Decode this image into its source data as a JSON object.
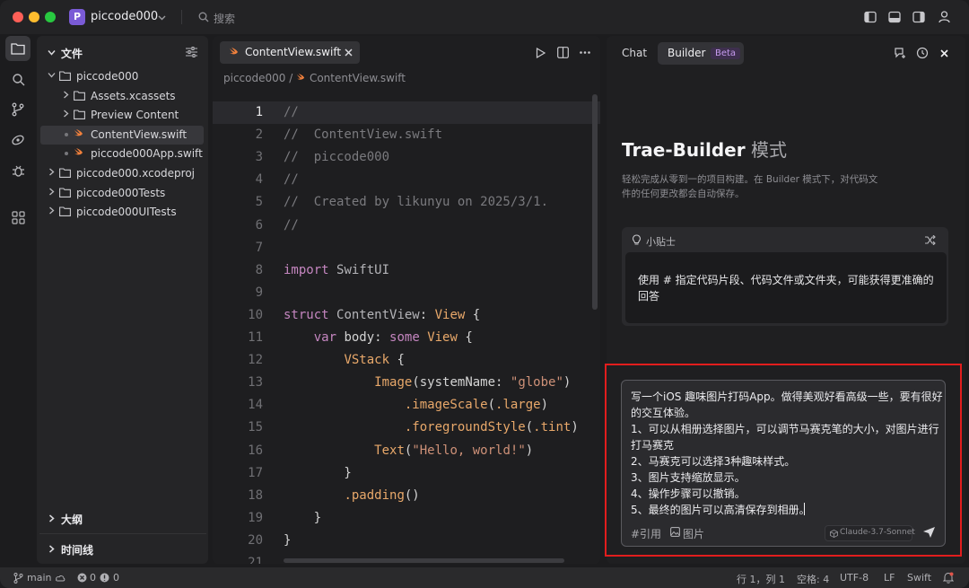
{
  "window": {
    "project_initial": "P",
    "project_name": "piccode000",
    "search_placeholder": "搜索"
  },
  "explorer": {
    "title": "文件",
    "tree": [
      {
        "label": "piccode000",
        "type": "folder",
        "expanded": true,
        "depth": 0
      },
      {
        "label": "Assets.xcassets",
        "type": "folder",
        "expanded": false,
        "depth": 1
      },
      {
        "label": "Preview Content",
        "type": "folder",
        "expanded": false,
        "depth": 1
      },
      {
        "label": "ContentView.swift",
        "type": "swift",
        "selected": true,
        "depth": 1
      },
      {
        "label": "piccode000App.swift",
        "type": "swift",
        "depth": 1
      },
      {
        "label": "piccode000.xcodeproj",
        "type": "folder",
        "expanded": false,
        "depth": 0
      },
      {
        "label": "piccode000Tests",
        "type": "folder",
        "expanded": false,
        "depth": 0
      },
      {
        "label": "piccode000UITests",
        "type": "folder",
        "expanded": false,
        "depth": 0
      }
    ],
    "outline_label": "大纲",
    "timeline_label": "时间线"
  },
  "editor": {
    "tab_label": "ContentView.swift",
    "breadcrumb": [
      "piccode000",
      "ContentView.swift"
    ],
    "breadcrumb_sep": "/",
    "current_line": 1,
    "lines": [
      {
        "n": "1",
        "text": "//"
      },
      {
        "n": "2",
        "text": "//  ContentView.swift"
      },
      {
        "n": "3",
        "text": "//  piccode000"
      },
      {
        "n": "4",
        "text": "//"
      },
      {
        "n": "5",
        "text": "//  Created by likunyu on 2025/3/1."
      },
      {
        "n": "6",
        "text": "//"
      },
      {
        "n": "7",
        "text": ""
      },
      {
        "n": "8",
        "text": "import SwiftUI"
      },
      {
        "n": "9",
        "text": ""
      },
      {
        "n": "10",
        "text": "struct ContentView: View {"
      },
      {
        "n": "11",
        "text": "    var body: some View {"
      },
      {
        "n": "12",
        "text": "        VStack {"
      },
      {
        "n": "13",
        "text": "            Image(systemName: \"globe\")"
      },
      {
        "n": "14",
        "text": "                .imageScale(.large)"
      },
      {
        "n": "15",
        "text": "                .foregroundStyle(.tint)"
      },
      {
        "n": "16",
        "text": "            Text(\"Hello, world!\")"
      },
      {
        "n": "17",
        "text": "        }"
      },
      {
        "n": "18",
        "text": "        .padding()"
      },
      {
        "n": "19",
        "text": "    }"
      },
      {
        "n": "20",
        "text": "}"
      },
      {
        "n": "21",
        "text": ""
      }
    ]
  },
  "panel": {
    "tab_chat": "Chat",
    "tab_builder": "Builder",
    "beta_badge": "Beta",
    "heading_main": "Trae-Builder",
    "heading_mode": "模式",
    "description_lines": [
      "轻松完成从零到一的项目构建。在 Builder 模式下，对代码文",
      "件的任何更改都会自动保存。"
    ],
    "tip_title": "小贴士",
    "tip_lines": [
      "使用 # 指定代码片段、代码文件或文件夹，可能获得更准确的",
      "回答"
    ],
    "input_lines": [
      "写一个iOS 趣味图片打码App。做得美观好看高级一些，要有很好",
      "的交互体验。",
      "1、可以从相册选择图片，可以调节马赛克笔的大小，对图片进行",
      "打马赛克",
      "2、马赛克可以选择3种趣味样式。",
      "3、图片支持缩放显示。",
      "4、操作步骤可以撤销。",
      "5、最终的图片可以高清保存到相册。"
    ],
    "ref_button": "#引用",
    "image_button": "图片",
    "model": "Claude-3.7-Sonnet",
    "highlight_color": "#e11d1d"
  },
  "status": {
    "branch": "main",
    "errors": "0",
    "warnings": "0",
    "cursor": "行 1，列 1",
    "indent": "空格: 4",
    "encoding": "UTF-8",
    "eol": "LF",
    "language": "Swift"
  }
}
